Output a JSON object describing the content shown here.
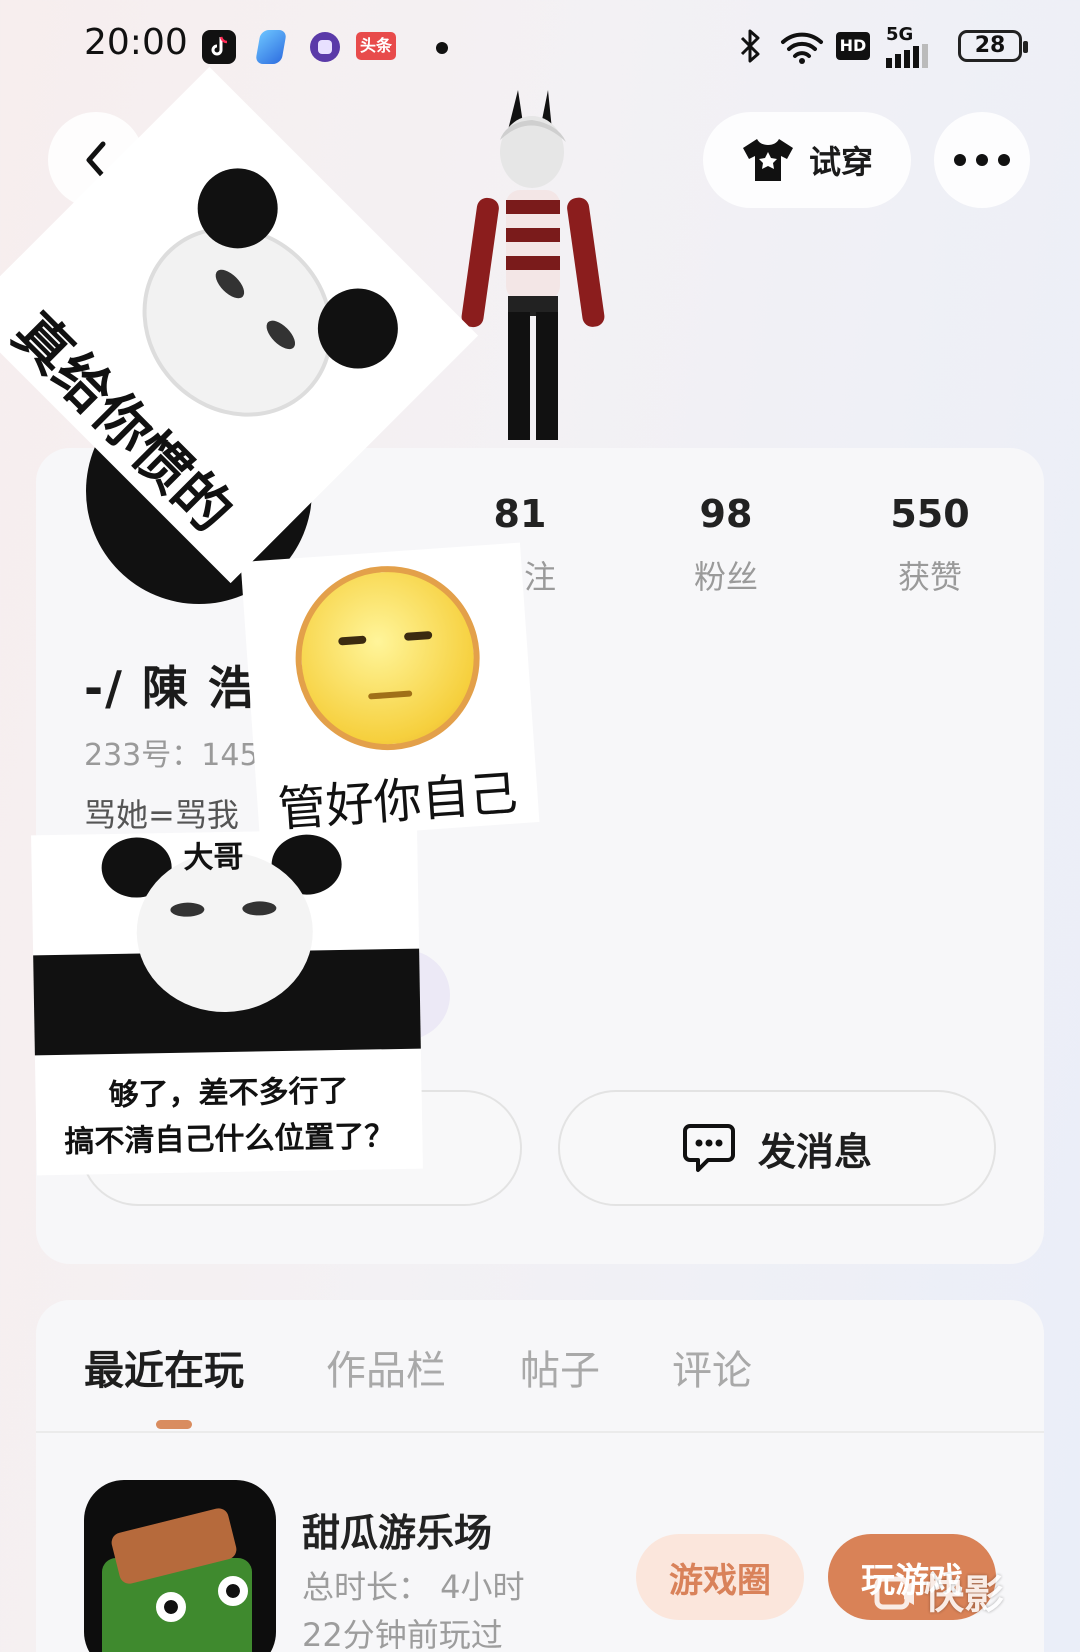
{
  "status_bar": {
    "time": "20:00",
    "network": "5G",
    "hd_badge": "HD",
    "battery": "28",
    "app_icons": [
      "tiktok-icon",
      "blue-app-icon",
      "purple-app-icon",
      "toutiao-icon"
    ],
    "toutiao_label": "头条"
  },
  "header": {
    "tryon_label": "试穿"
  },
  "profile": {
    "name": "-/ 陳 浩",
    "id_label": "233号：",
    "id_value_partial": "145",
    "bio_partial": "骂她=骂我",
    "stats": [
      {
        "value": "81",
        "label": "关注",
        "label_visible": "注"
      },
      {
        "value": "98",
        "label": "粉丝"
      },
      {
        "value": "550",
        "label": "获赞"
      }
    ],
    "message_button": "发消息"
  },
  "stickers": {
    "panda1_caption": "真给你惯的",
    "moon_caption": "管好你自己",
    "panda2_top": "大哥",
    "panda2_caption_line1": "够了，差不多行了",
    "panda2_caption_line2": "搞不清自己什么位置了？"
  },
  "tabs": [
    {
      "label": "最近在玩",
      "active": true
    },
    {
      "label": "作品栏",
      "active": false
    },
    {
      "label": "帖子",
      "active": false
    },
    {
      "label": "评论",
      "active": false
    }
  ],
  "game": {
    "title": "甜瓜游乐场",
    "total_time": "总时长：  4小时",
    "last_played": "22分钟前玩过",
    "circle_button": "游戏圈",
    "play_button": "玩游戏"
  },
  "watermark": "快影",
  "colors": {
    "accent": "#d98257",
    "accent_light": "#fbe6dc",
    "text_primary": "#1e1e1e",
    "text_muted": "#9a9a9a"
  }
}
